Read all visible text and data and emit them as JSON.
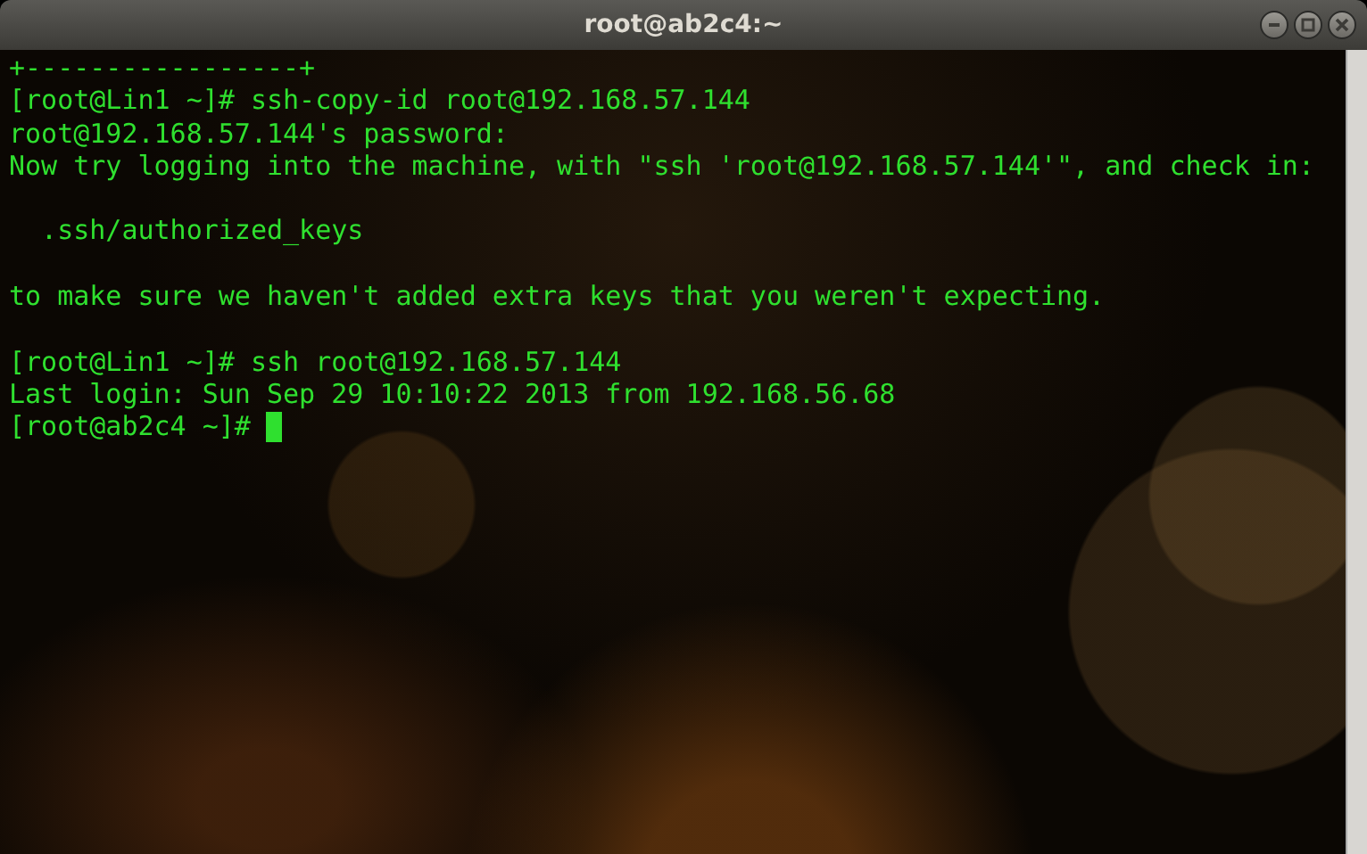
{
  "window": {
    "title": "root@ab2c4:~"
  },
  "terminal": {
    "lines": [
      {
        "text": "+-----------------+",
        "blank_before": false,
        "cursor": false
      },
      {
        "text": "[root@Lin1 ~]# ssh-copy-id root@192.168.57.144",
        "blank_before": false,
        "cursor": false
      },
      {
        "text": "root@192.168.57.144's password:",
        "blank_before": false,
        "cursor": false
      },
      {
        "text": "Now try logging into the machine, with \"ssh 'root@192.168.57.144'\", and check in:",
        "blank_before": false,
        "cursor": false
      },
      {
        "text": "  .ssh/authorized_keys",
        "blank_before": true,
        "cursor": false
      },
      {
        "text": "to make sure we haven't added extra keys that you weren't expecting.",
        "blank_before": true,
        "cursor": false
      },
      {
        "text": "[root@Lin1 ~]# ssh root@192.168.57.144",
        "blank_before": true,
        "cursor": false
      },
      {
        "text": "Last login: Sun Sep 29 10:10:22 2013 from 192.168.56.68",
        "blank_before": false,
        "cursor": false
      },
      {
        "text": "[root@ab2c4 ~]#",
        "blank_before": false,
        "cursor": true
      }
    ]
  }
}
